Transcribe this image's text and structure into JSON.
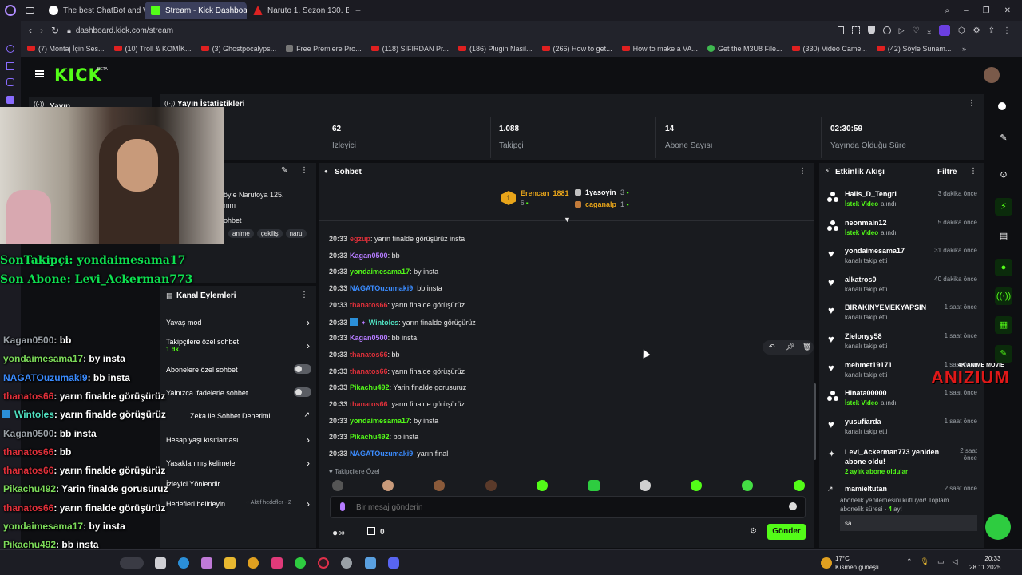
{
  "browser": {
    "tabs": [
      {
        "label": "The best ChatBot and Wi",
        "icon": "chatbot-favicon"
      },
      {
        "label": "Stream - Kick Dashboard",
        "icon": "kick-favicon"
      },
      {
        "label": "Naruto 1. Sezon 130. Bölü",
        "icon": "anime-favicon"
      }
    ],
    "url": "dashboard.kick.com/stream",
    "bookmarks": [
      "(7) Montaj İçin Ses...",
      "(10) Troll & KOMİK...",
      "(3) Ghostpocalyps...",
      "Free Premiere Pro...",
      "(118) SIFIRDAN Pr...",
      "(186) Plugin Nasil...",
      "(266) How to get...",
      "How to make a VA...",
      "Get the M3U8 File...",
      "(330) Video Came...",
      "(42) Söyle Sunam..."
    ]
  },
  "kick": {
    "logo": "KICK",
    "logo_badge": "BETA",
    "sidebar_label": "Yayın"
  },
  "stats": {
    "title": "Yayın İstatistikleri",
    "items": [
      {
        "value": "62",
        "label": "İzleyici"
      },
      {
        "value": "1.088",
        "label": "Takipçi"
      },
      {
        "value": "14",
        "label": "Abone Sayısı"
      },
      {
        "value": "02:30:59",
        "label": "Yayında Olduğu Süre"
      }
    ]
  },
  "stream_info": {
    "title_line1": "öyle Narutoya 125.",
    "title_line2": "mm",
    "category": "ohbet",
    "tags": [
      "anime",
      "çekiliş",
      "naru"
    ]
  },
  "overlay": {
    "last_follower": "SonTakipçi: yondaimesama17",
    "last_sub": "Son Abone: Levi_Ackerman773",
    "chat": [
      {
        "user": "Kagan0500",
        "msg": ": bb",
        "color": "#9aa0a6"
      },
      {
        "user": "yondaimesama17",
        "msg": ": by insta",
        "color": "#7ddc5a"
      },
      {
        "user": "NAGATOuzumaki9",
        "msg": ": bb insta",
        "color": "#3b8cff"
      },
      {
        "user": "thanatos66",
        "msg": ": yarın finalde görüşürüz",
        "color": "#e0303a"
      },
      {
        "user": "Wintoles",
        "msg": ": yarın finalde görüşürüz",
        "color": "#4fe0c0"
      },
      {
        "user": "Kagan0500",
        "msg": ": bb insta",
        "color": "#9aa0a6"
      },
      {
        "user": "thanatos66",
        "msg": ": bb",
        "color": "#e0303a"
      },
      {
        "user": "thanatos66",
        "msg": ": yarın finalde görüşürüz",
        "color": "#e0303a"
      },
      {
        "user": "Pikachu492",
        "msg": ": Yarin finalde gorusuruz",
        "color": "#7ddc5a"
      },
      {
        "user": "thanatos66",
        "msg": ": yarın finalde görüşürüz",
        "color": "#e0303a"
      },
      {
        "user": "yondaimesama17",
        "msg": ": by insta",
        "color": "#7ddc5a"
      },
      {
        "user": "Pikachu492",
        "msg": ": bb insta",
        "color": "#7ddc5a"
      },
      {
        "user": "",
        "msg": ": yarın final",
        "color": "#ffffff"
      }
    ]
  },
  "channel_actions": {
    "title": "Kanal Eylemleri",
    "items": [
      {
        "label": "Yavaş mod",
        "control": "chevron"
      },
      {
        "label": "Takipçilere özel sohbet",
        "sublabel": "1 dk.",
        "control": "chevron"
      },
      {
        "label": "Abonelere özel sohbet",
        "control": "toggle"
      },
      {
        "label": "Yalnızca ifadelerle sohbet",
        "control": "toggle"
      },
      {
        "label": "Zeka ile Sohbet Denetimi",
        "control": "chart"
      },
      {
        "label": "Hesap yaşı kısıtlaması",
        "control": "chevron"
      },
      {
        "label": "Yasaklanmış kelimeler",
        "control": "chevron"
      },
      {
        "label": "İzleyici Yönlendir",
        "control": "none"
      },
      {
        "label": "Hedefleri belirleyin",
        "badge": "Aktif hedefler - 2",
        "control": "chevron"
      }
    ]
  },
  "chat": {
    "title": "Sohbet",
    "leaderboard": [
      {
        "rank": "1",
        "user": "Erencan_1881",
        "count": "6"
      },
      {
        "user": "1yasoyin",
        "count": "3"
      },
      {
        "user": "caganalp",
        "count": "1"
      }
    ],
    "messages": [
      {
        "time": "20:33",
        "user": "egzup",
        "msg": ": yarın finalde görüşürüz insta",
        "color": "#e0303a"
      },
      {
        "time": "20:33",
        "user": "Kagan0500",
        "msg": ": bb",
        "color": "#b57bff"
      },
      {
        "time": "20:33",
        "user": "yondaimesama17",
        "msg": ": by insta",
        "color": "#53fc18"
      },
      {
        "time": "20:33",
        "user": "NAGATOuzumaki9",
        "msg": ": bb insta",
        "color": "#3b8cff"
      },
      {
        "time": "20:33",
        "user": "thanatos66",
        "msg": ": yarın finalde görüşürüz",
        "color": "#e0303a"
      },
      {
        "time": "20:33",
        "user": "Wintoles",
        "msg": ": yarın finalde görüşürüz",
        "color": "#4fe0c0",
        "badges": true
      },
      {
        "time": "20:33",
        "user": "Kagan0500",
        "msg": ": bb insta",
        "color": "#b57bff"
      },
      {
        "time": "20:33",
        "user": "thanatos66",
        "msg": ": bb",
        "color": "#e0303a"
      },
      {
        "time": "20:33",
        "user": "thanatos66",
        "msg": ": yarın finalde görüşürüz",
        "color": "#e0303a"
      },
      {
        "time": "20:33",
        "user": "Pikachu492",
        "msg": ": Yarin finalde gorusuruz",
        "color": "#53fc18"
      },
      {
        "time": "20:33",
        "user": "thanatos66",
        "msg": ": yarın finalde görüşürüz",
        "color": "#e0303a"
      },
      {
        "time": "20:33",
        "user": "yondaimesama17",
        "msg": ": by insta",
        "color": "#53fc18"
      },
      {
        "time": "20:33",
        "user": "Pikachu492",
        "msg": ": bb insta",
        "color": "#53fc18"
      },
      {
        "time": "20:33",
        "user": "NAGATOuzumaki9",
        "msg": ": yarın final",
        "color": "#3b8cff"
      }
    ],
    "followers_only_label": "Takipçilere Özel",
    "input_placeholder": "Bir mesaj gönderin",
    "points_value": "0",
    "send_label": "Gönder"
  },
  "activity": {
    "title": "Etkinlik Akışı",
    "filter_label": "Filtre",
    "items": [
      {
        "user": "Halis_D_Tengri",
        "sub": "alındı",
        "highlight": "İstek Video",
        "time": "3 dakika önce",
        "icon": "video-request-icon"
      },
      {
        "user": "neonmain12",
        "sub": "alındı",
        "highlight": "İstek Video",
        "time": "5 dakika önce",
        "icon": "video-request-icon"
      },
      {
        "user": "yondaimesama17",
        "sub": "kanalı takip etti",
        "time": "31 dakika önce",
        "icon": "heart-icon"
      },
      {
        "user": "alkatros0",
        "sub": "kanalı takip etti",
        "time": "40 dakika önce",
        "icon": "heart-icon"
      },
      {
        "user": "BIRAKINYEMEKYAPSIN",
        "sub": "kanalı takip etti",
        "time": "1 saat önce",
        "icon": "heart-icon"
      },
      {
        "user": "Zielonyy58",
        "sub": "kanalı takip etti",
        "time": "1 saat önce",
        "icon": "heart-icon"
      },
      {
        "user": "mehmet19171",
        "sub": "kanalı takip etti",
        "time": "1 saat önce",
        "icon": "heart-icon"
      },
      {
        "user": "Hinata00000",
        "sub": "alındı",
        "highlight": "İstek Video",
        "time": "1 saat önce",
        "icon": "video-request-icon"
      },
      {
        "user": "yusufiarda",
        "sub": "kanalı takip etti",
        "time": "1 saat önce",
        "icon": "heart-icon"
      }
    ],
    "resub": {
      "line1": "Levi_Ackerman773 yeniden",
      "line2": "abone oldu!",
      "detail": "2 aylık abone oldular",
      "time1": "2 saat",
      "time2": "önce"
    },
    "gift": {
      "user": "mamieltutan",
      "time": "2 saat önce",
      "line1": "abonelik yenilemesini kutluyor! Toplam",
      "line2_prefix": "abonelik süresi - ",
      "months": "4",
      "line2_suffix": " ay!",
      "message": "sa"
    }
  },
  "watermark": {
    "top": "4K ANIME MOVIE",
    "main": "ANIZIUM"
  },
  "taskbar": {
    "weather_temp": "17°C",
    "weather_text": "Kısmen güneşli",
    "time": "20:33",
    "date": "28.11.2025"
  },
  "colors": {
    "kick_green": "#53fc18",
    "panel": "#191b1f",
    "bg": "#0e0f12"
  }
}
